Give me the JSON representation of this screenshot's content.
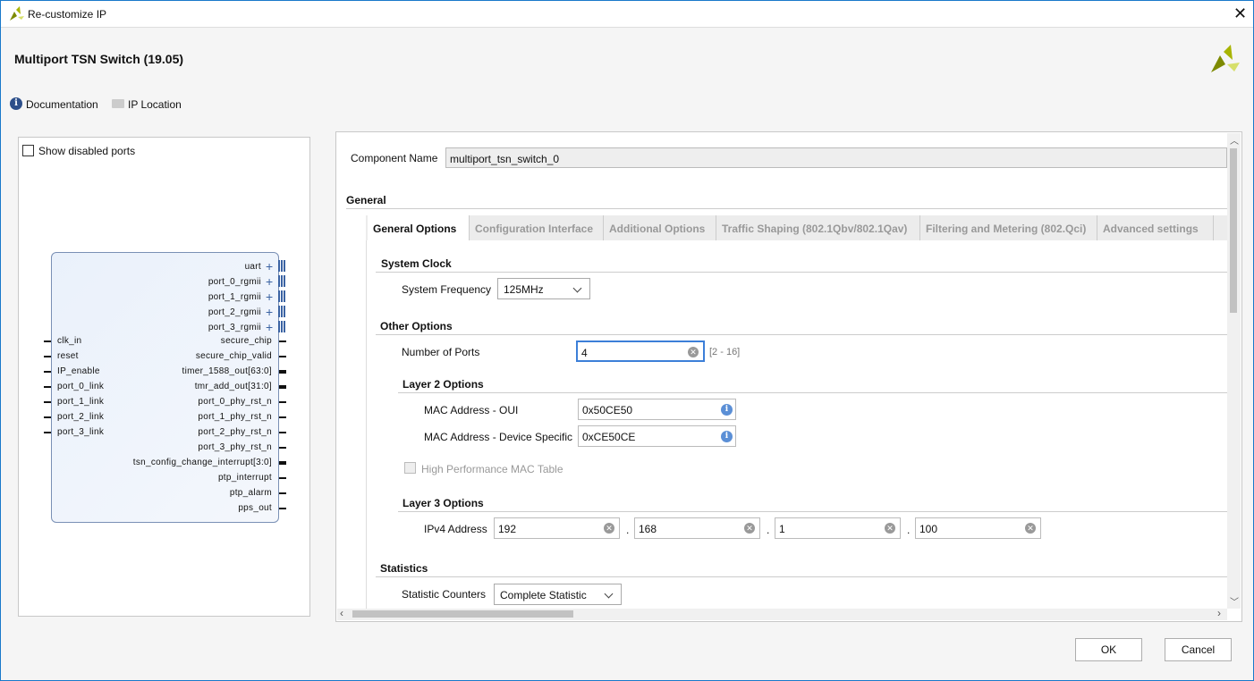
{
  "window": {
    "title": "Re-customize IP",
    "close_icon": "close-icon"
  },
  "header": {
    "title": "Multiport TSN Switch (19.05)",
    "documentation": "Documentation",
    "ip_location": "IP Location"
  },
  "left_panel": {
    "show_disabled_ports": "Show disabled ports",
    "checked": false,
    "bus_ports": [
      "uart",
      "port_0_rgmii",
      "port_1_rgmii",
      "port_2_rgmii",
      "port_3_rgmii"
    ],
    "inputs": [
      "clk_in",
      "reset",
      "IP_enable",
      "port_0_link",
      "port_1_link",
      "port_2_link",
      "port_3_link"
    ],
    "outputs": [
      {
        "name": "secure_chip",
        "bus": false
      },
      {
        "name": "secure_chip_valid",
        "bus": false
      },
      {
        "name": "timer_1588_out[63:0]",
        "bus": true
      },
      {
        "name": "tmr_add_out[31:0]",
        "bus": true
      },
      {
        "name": "port_0_phy_rst_n",
        "bus": false
      },
      {
        "name": "port_1_phy_rst_n",
        "bus": false
      },
      {
        "name": "port_2_phy_rst_n",
        "bus": false
      },
      {
        "name": "port_3_phy_rst_n",
        "bus": false
      },
      {
        "name": "tsn_config_change_interrupt[3:0]",
        "bus": true
      },
      {
        "name": "ptp_interrupt",
        "bus": false
      },
      {
        "name": "ptp_alarm",
        "bus": false
      },
      {
        "name": "pps_out",
        "bus": false
      }
    ]
  },
  "main": {
    "component_name_label": "Component Name",
    "component_name": "multiport_tsn_switch_0",
    "general": "General",
    "tabs": [
      "General Options",
      "Configuration Interface",
      "Additional Options",
      "Traffic Shaping (802.1Qbv/802.1Qav)",
      "Filtering and Metering (802.Qci)",
      "Advanced settings"
    ],
    "system_clock": "System Clock",
    "system_frequency_label": "System Frequency",
    "system_frequency": "125MHz",
    "other_options": "Other Options",
    "num_ports_label": "Number of Ports",
    "num_ports": "4",
    "num_ports_range": "[2 - 16]",
    "layer2": "Layer 2 Options",
    "oui_label": "MAC Address - OUI",
    "oui": "0x50CE50",
    "dev_label": "MAC Address - Device Specific",
    "dev": "0xCE50CE",
    "hp_mac": "High Performance MAC Table",
    "hp_mac_checked": false,
    "layer3": "Layer 3 Options",
    "ipv4_label": "IPv4 Address",
    "ipv4": [
      "192",
      "168",
      "1",
      "100"
    ],
    "dot": ".",
    "statistics": "Statistics",
    "stat_label": "Statistic Counters",
    "stat": "Complete Statistic"
  },
  "footer": {
    "ok": "OK",
    "cancel": "Cancel"
  },
  "colors": {
    "accent": "#1979ca",
    "logo": "#a8b400"
  }
}
